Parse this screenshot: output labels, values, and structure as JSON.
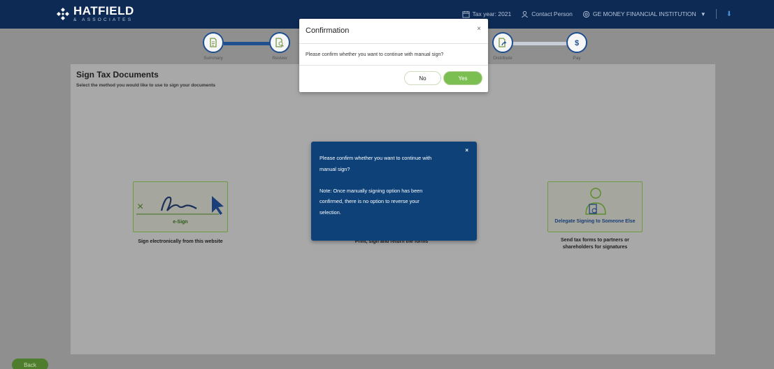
{
  "brand": {
    "name": "HATFIELD",
    "sub": "& ASSOCIATES"
  },
  "header": {
    "tax_year": "Tax year: 2021",
    "contact_person": "Contact Person",
    "institution": "GE MONEY FINANCIAL INSTITUTION",
    "caret": "▼",
    "download": "⬇"
  },
  "stepper": {
    "steps": [
      {
        "label": "Summary",
        "icon": "document-icon"
      },
      {
        "label": "Review",
        "icon": "search-document-icon"
      },
      {
        "label": "Distribute",
        "icon": "share-document-icon"
      },
      {
        "label": "Pay",
        "icon": "dollar-icon"
      }
    ]
  },
  "main": {
    "title": "Sign Tax Documents",
    "subtitle": "Select the method you would like to use to sign your documents",
    "options": [
      {
        "label": "e-Sign",
        "caption": "Sign electronically from this website"
      },
      {
        "label": "",
        "caption": "Print, sign and return the forms"
      },
      {
        "label": "Delegate Signing to Someone Else",
        "caption_line1": "Send tax forms to partners or",
        "caption_line2": "shareholders for signatures"
      }
    ],
    "back_label": "Back"
  },
  "modal": {
    "title": "Confirmation",
    "close": "×",
    "message": "Please confirm whether you want to continue with manual sign?",
    "no_label": "No",
    "yes_label": "Yes"
  },
  "note_popup": {
    "close": "×",
    "line1": "Please confirm whether you want to continue with",
    "line2": "manual sign?",
    "line3": "Note: Once manually signing option has been",
    "line4": "confirmed, there is no option to reverse your",
    "line5": "selection."
  },
  "colors": {
    "navy": "#0d2a54",
    "step_blue": "#1f4f8f",
    "accent_green": "#7bbf52",
    "popup_blue": "#0d4178"
  }
}
